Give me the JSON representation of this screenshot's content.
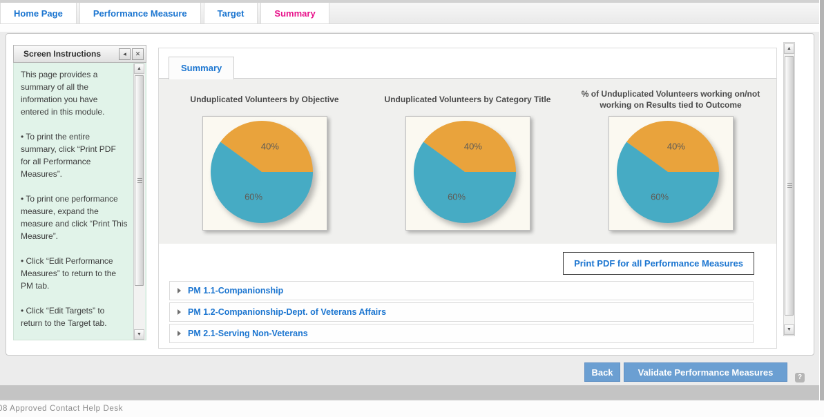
{
  "tabs": {
    "items": [
      {
        "label": "Home Page"
      },
      {
        "label": "Performance Measure"
      },
      {
        "label": "Target"
      },
      {
        "label": "Summary",
        "active": true
      }
    ]
  },
  "instructions": {
    "title": "Screen Instructions",
    "collapse_icon": "◂",
    "close_icon": "✕",
    "paragraphs": [
      "This page provides a summary of all the information you have entered in this module.",
      "• To print the entire summary, click “Print PDF for all Performance Measures”.",
      "• To print one performance measure, expand the measure and click “Print This Measure”.",
      "• Click “Edit Performance Measures” to return to the PM tab.",
      "• Click “Edit Targets” to return to the Target tab."
    ]
  },
  "summary": {
    "tab_label": "Summary",
    "print_button": "Print PDF for all Performance Measures",
    "measures": [
      "PM 1.1-Companionship",
      "PM 1.2-Companionship-Dept. of Veterans Affairs",
      "PM 2.1-Serving Non-Veterans"
    ]
  },
  "chart_data": [
    {
      "type": "pie",
      "title": "Unduplicated Volunteers by Objective",
      "labels": [
        "40%",
        "60%"
      ],
      "values": [
        40,
        60
      ],
      "colors": [
        "#E9A33C",
        "#46ABC4"
      ],
      "start_angle": 0,
      "legend": "none"
    },
    {
      "type": "pie",
      "title": "Unduplicated Volunteers by Category Title",
      "labels": [
        "40%",
        "60%"
      ],
      "values": [
        40,
        60
      ],
      "colors": [
        "#E9A33C",
        "#46ABC4"
      ],
      "start_angle": 0,
      "legend": "none"
    },
    {
      "type": "pie",
      "title": "% of Unduplicated Volunteers working on/not working on Results tied to Outcome",
      "labels": [
        "40%",
        "60%"
      ],
      "values": [
        40,
        60
      ],
      "colors": [
        "#E9A33C",
        "#46ABC4"
      ],
      "start_angle": 0,
      "legend": "none"
    }
  ],
  "actions": {
    "back_label": "Back",
    "validate_label": "Validate Performance Measures",
    "help_label": "?"
  },
  "footer": {
    "text": "08 Approved Contact Help Desk"
  },
  "colors": {
    "tab_blue": "#1b75d0",
    "tab_pink": "#e8138b",
    "button_blue": "#6b9fd2",
    "pie_orange": "#E9A33C",
    "pie_teal": "#46ABC4",
    "instructions_bg": "#e1f3e9"
  }
}
